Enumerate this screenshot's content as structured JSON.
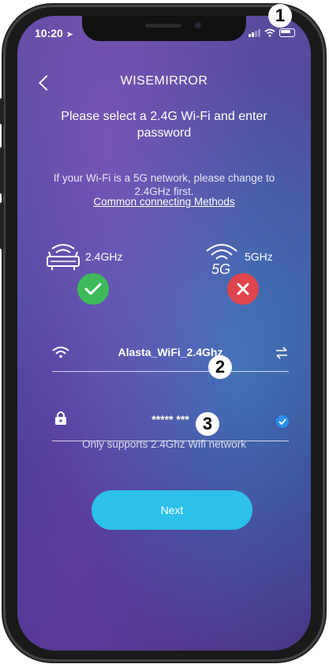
{
  "status_bar": {
    "time": "10:20"
  },
  "header": {
    "title": "WISEMIRROR"
  },
  "instructions": {
    "heading": "Please select a 2.4G Wi-Fi and enter password",
    "info": "If your Wi-Fi is a 5G network, please change to 2.4GHz first.",
    "link": "Common connecting Methods"
  },
  "bands": [
    {
      "label": "2.4GHz",
      "icon": "router-icon",
      "status": "supported",
      "status_color": "#3dbb5c"
    },
    {
      "label": "5GHz",
      "icon": "wifi-5g-icon",
      "status": "not-supported",
      "status_color": "#e0454c"
    }
  ],
  "form": {
    "ssid_value": "Alasta_WiFi_2.4Ghz",
    "password_value": "***** ***",
    "hint": "Only supports 2.4Ghz Wifi network"
  },
  "actions": {
    "next_label": "Next",
    "accent": "#2cc0ea"
  },
  "callouts": {
    "one": "1",
    "two": "2",
    "three": "3"
  }
}
